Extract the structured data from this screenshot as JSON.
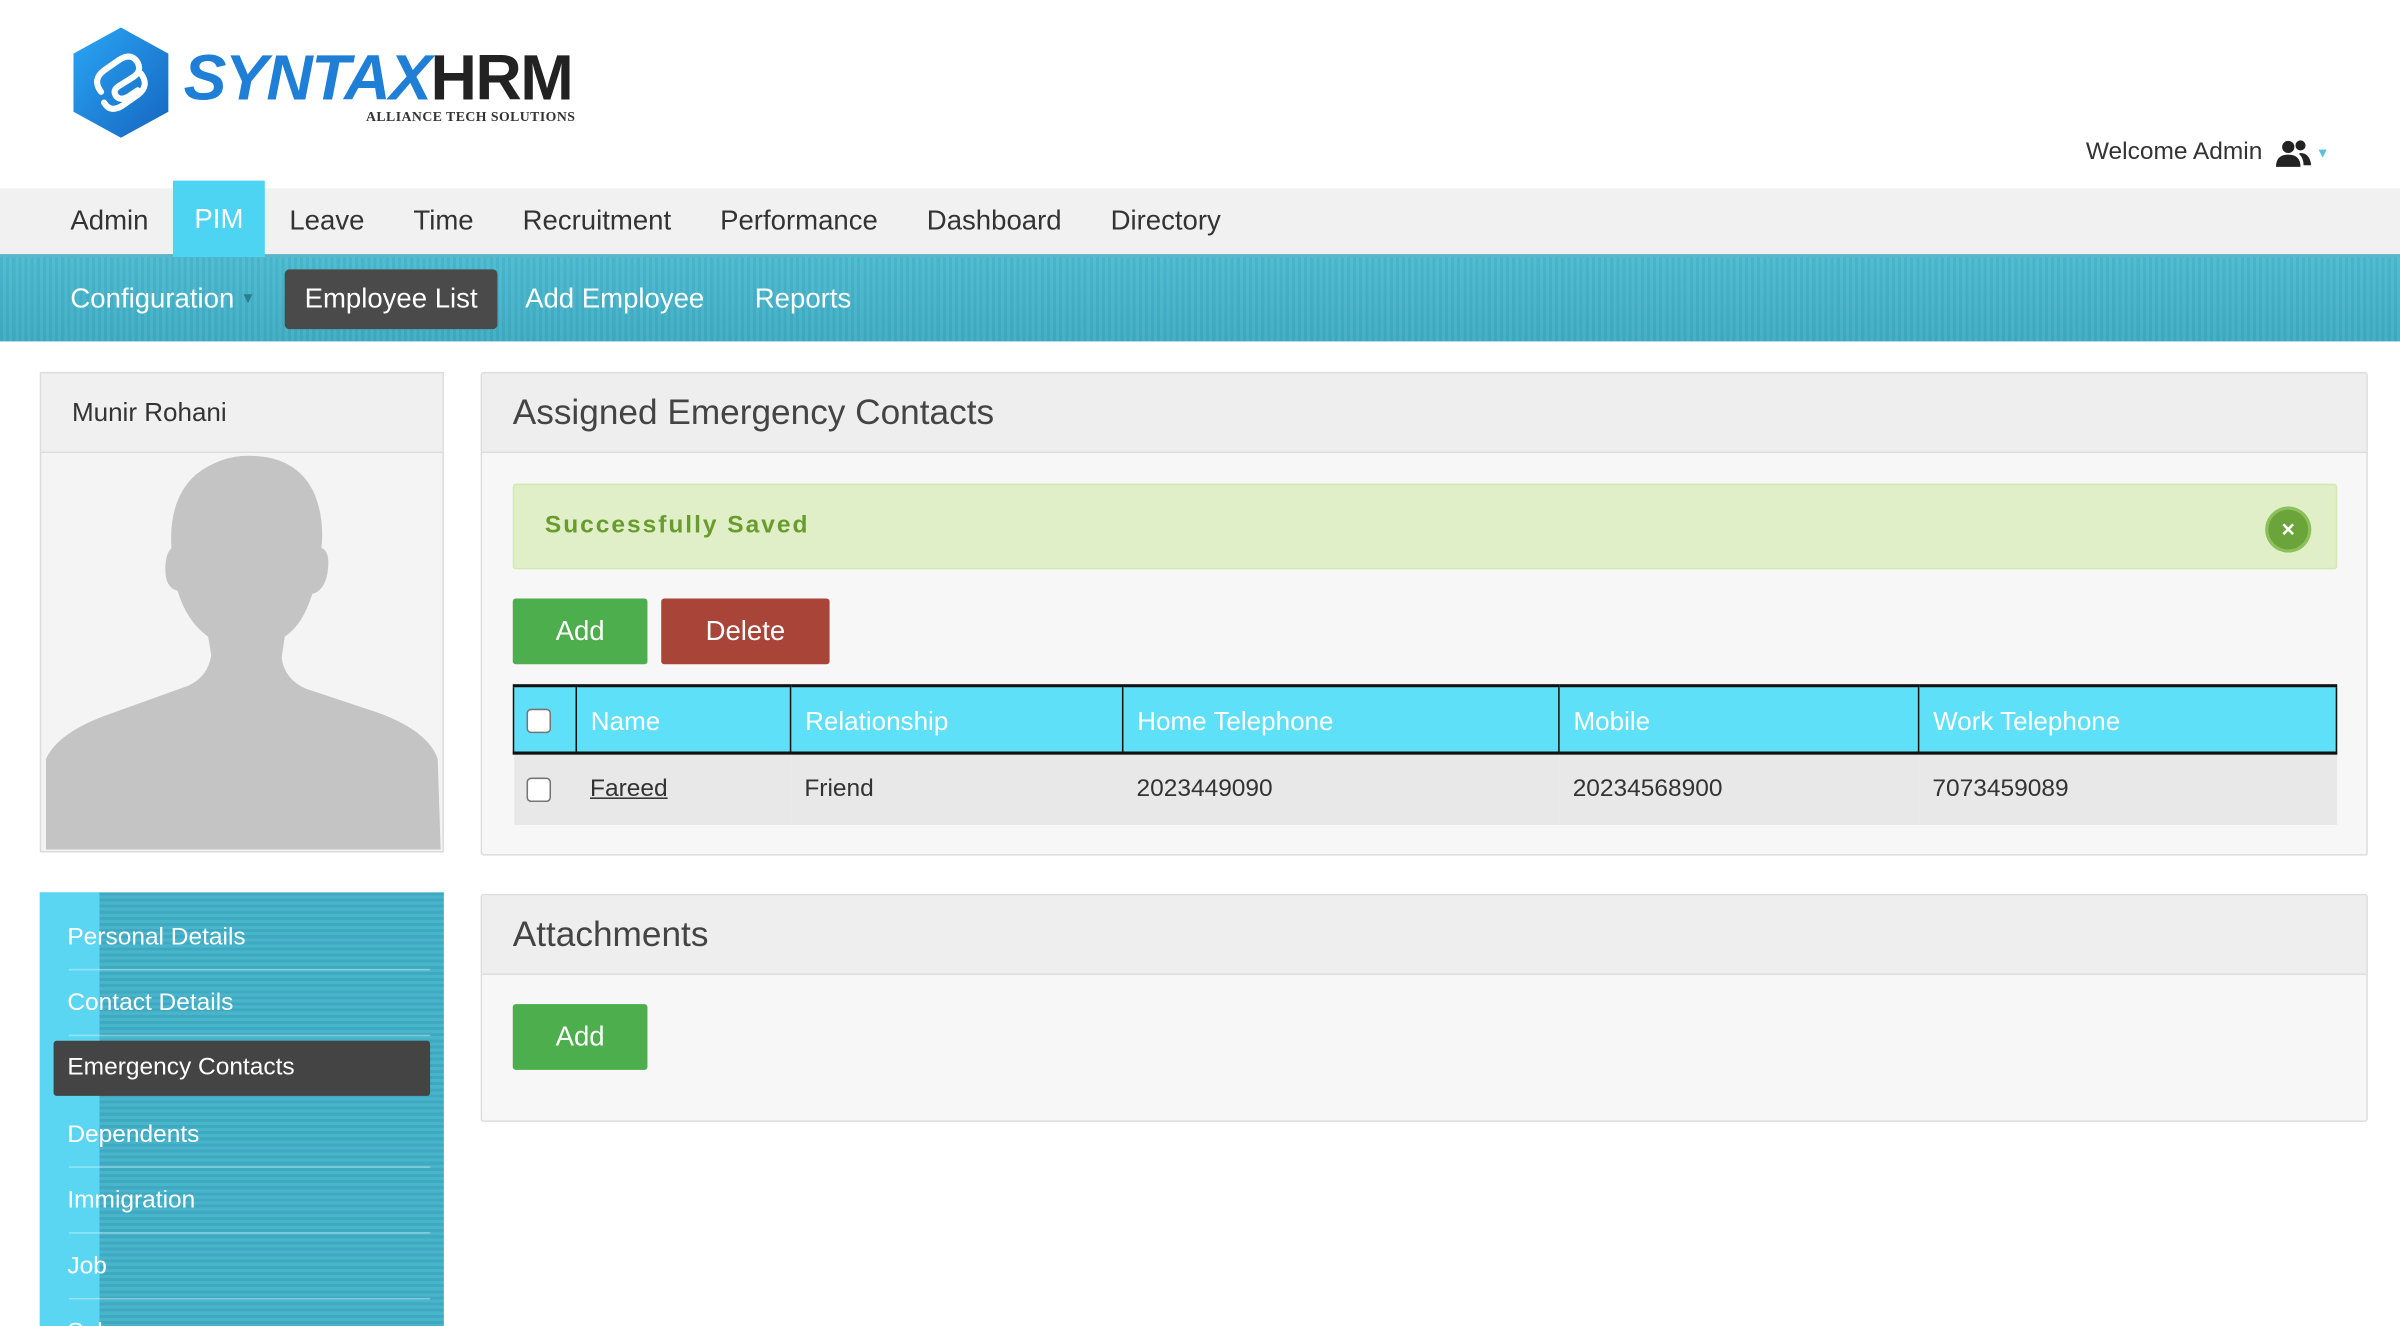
{
  "logo": {
    "word1": "SYNTAX",
    "word2": "HRM",
    "tagline": "ALLIANCE TECH SOLUTIONS"
  },
  "header": {
    "welcome": "Welcome Admin"
  },
  "main_menu": [
    {
      "label": "Admin",
      "active": false
    },
    {
      "label": "PIM",
      "active": true
    },
    {
      "label": "Leave",
      "active": false
    },
    {
      "label": "Time",
      "active": false
    },
    {
      "label": "Recruitment",
      "active": false
    },
    {
      "label": "Performance",
      "active": false
    },
    {
      "label": "Dashboard",
      "active": false
    },
    {
      "label": "Directory",
      "active": false
    }
  ],
  "sub_menu": [
    {
      "label": "Configuration",
      "dropdown": true,
      "active": false
    },
    {
      "label": "Employee List",
      "active": true
    },
    {
      "label": "Add Employee",
      "active": false
    },
    {
      "label": "Reports",
      "active": false
    }
  ],
  "profile": {
    "name": "Munir Rohani"
  },
  "side_nav": [
    {
      "label": "Personal Details",
      "active": false
    },
    {
      "label": "Contact Details",
      "active": false
    },
    {
      "label": "Emergency Contacts",
      "active": true
    },
    {
      "label": "Dependents",
      "active": false
    },
    {
      "label": "Immigration",
      "active": false
    },
    {
      "label": "Job",
      "active": false
    },
    {
      "label": "Salary",
      "active": false
    }
  ],
  "emergency": {
    "title": "Assigned Emergency Contacts",
    "message": "Successfully Saved",
    "close_symbol": "×",
    "add_label": "Add",
    "delete_label": "Delete",
    "columns": [
      "Name",
      "Relationship",
      "Home Telephone",
      "Mobile",
      "Work Telephone"
    ],
    "rows": [
      {
        "name": "Fareed",
        "relationship": "Friend",
        "home": "2023449090",
        "mobile": "20234568900",
        "work": "7073459089"
      }
    ]
  },
  "attachments": {
    "title": "Attachments",
    "add_label": "Add"
  },
  "colors": {
    "accent": "#4dd4f2",
    "header_teal": "#43b3cb",
    "success_bg": "#e1efc8",
    "green_btn": "#4cae4c",
    "red_btn": "#a94438"
  }
}
